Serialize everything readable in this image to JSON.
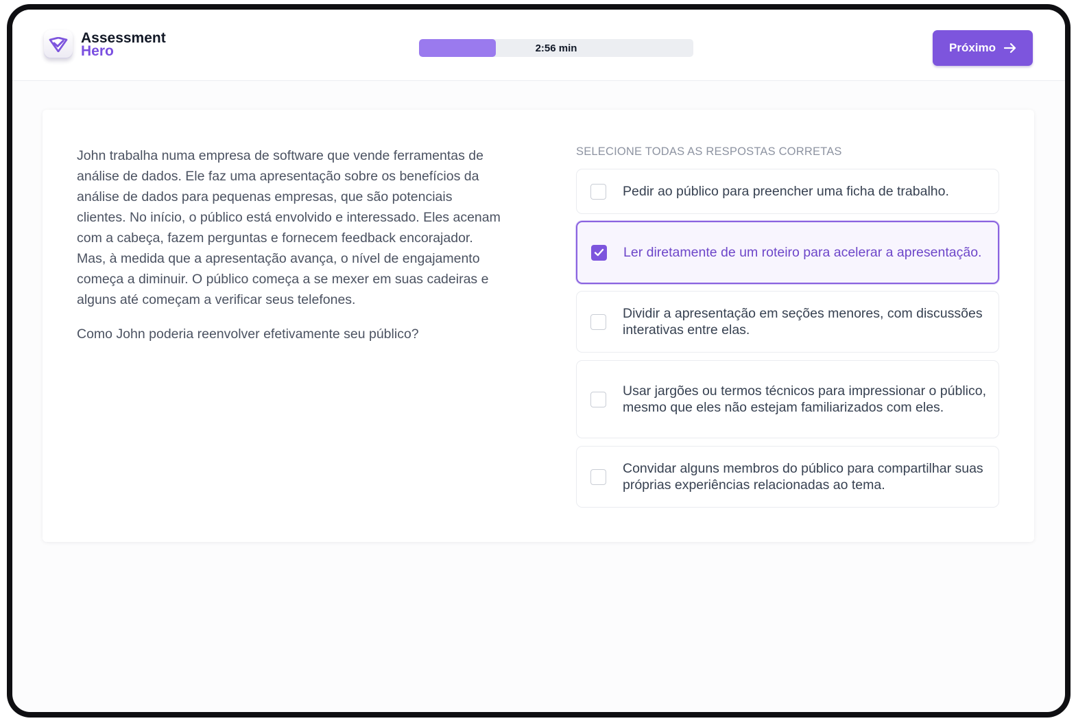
{
  "header": {
    "logo_line1": "Assessment",
    "logo_line2": "Hero",
    "logo_icon": "shield-check-icon",
    "timer_label": "2:56 min",
    "timer_progress_fraction": 0.28,
    "next_button_label": "Próximo",
    "next_button_icon": "arrow-right-icon"
  },
  "question": {
    "scenario": "John trabalha numa empresa de software que vende ferramentas de análise de dados. Ele faz uma apresentação sobre os benefícios da análise de dados para pequenas empresas, que são potenciais clientes. No início, o público está envolvido e interessado. Eles acenam com a cabeça, fazem perguntas e fornecem feedback encorajador. Mas, à medida que a apresentação avança, o nível de engajamento começa a diminuir. O público começa a se mexer em suas cadeiras e alguns até começam a verificar seus telefones.",
    "prompt": "Como John poderia reenvolver efetivamente seu público?"
  },
  "answers": {
    "heading": "SELECIONE TODAS AS RESPOSTAS CORRETAS",
    "options": [
      {
        "label": "Pedir ao público para preencher uma ficha de trabalho.",
        "checked": false
      },
      {
        "label": "Ler diretamente de um roteiro para acelerar a apresentação.",
        "checked": true
      },
      {
        "label": "Dividir a apresentação em seções menores, com discussões interativas entre elas.",
        "checked": false
      },
      {
        "label": "Usar jargões ou termos técnicos para impressionar o público, mesmo que eles não estejam familiarizados com eles.",
        "checked": false
      },
      {
        "label": "Convidar alguns membros do público para compartilhar suas próprias experiências relacionadas ao tema.",
        "checked": false
      }
    ]
  },
  "colors": {
    "accent": "#7d55dd",
    "progress_fill": "#9a7aee",
    "selected_text": "#6d46c9",
    "body_text": "#4b5261"
  }
}
